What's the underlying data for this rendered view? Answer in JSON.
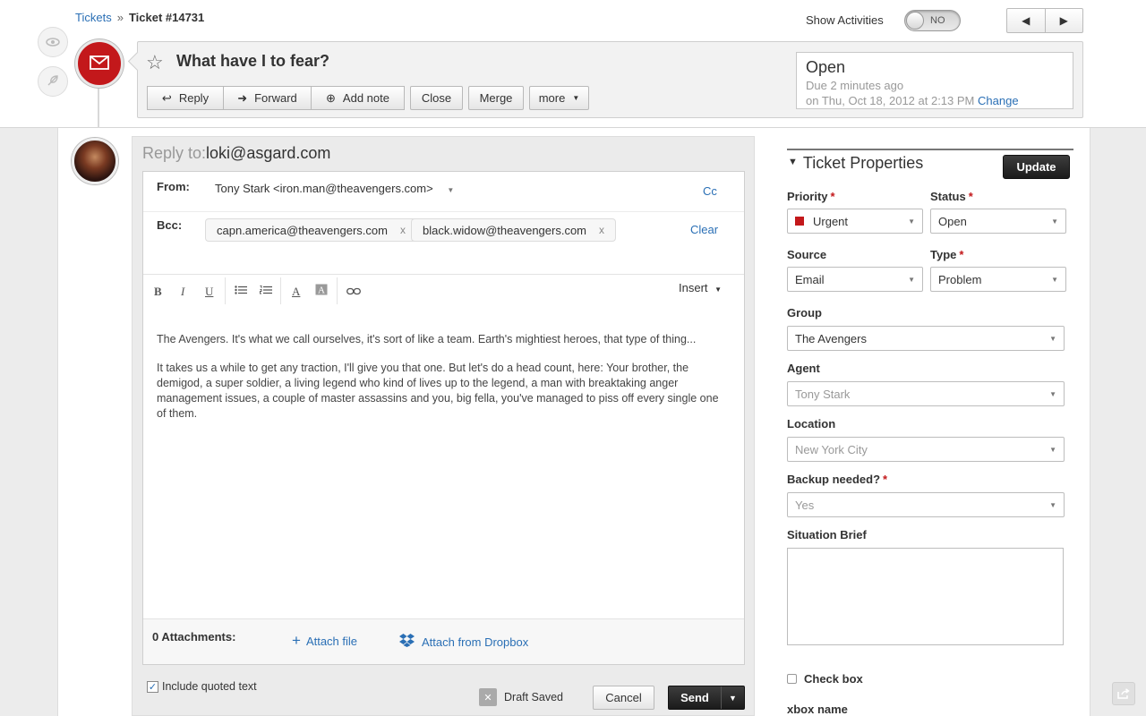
{
  "breadcrumb": {
    "root": "Tickets",
    "separator": "»",
    "current": "Ticket #14731"
  },
  "activities": {
    "label": "Show Activities",
    "toggle": "NO"
  },
  "ticket": {
    "subject": "What have I to fear?",
    "actions": {
      "reply": "Reply",
      "forward": "Forward",
      "add_note": "Add note",
      "close": "Close",
      "merge": "Merge",
      "more": "more"
    },
    "status": {
      "state": "Open",
      "due": "Due 2 minutes ago",
      "on": "on Thu, Oct 18, 2012 at 2:13 PM",
      "change": "Change"
    }
  },
  "reply": {
    "to_label": "Reply to:",
    "to_value": "loki@asgard.com",
    "from_label": "From:",
    "from_value": "Tony Stark <iron.man@theavengers.com>",
    "cc": "Cc",
    "bcc_label": "Bcc:",
    "bcc": [
      {
        "email": "capn.america@theavengers.com",
        "remove": "x"
      },
      {
        "email": "black.widow@theavengers.com",
        "remove": "x"
      }
    ],
    "clear": "Clear",
    "insert": "Insert",
    "body": [
      "The Avengers. It's what we call ourselves, it's sort of like a team. Earth's mightiest heroes, that type of thing...",
      "It takes us a while to get any traction, I'll give you that one. But let's do a head count, here: Your brother, the demigod, a super soldier, a living legend who kind of lives up to the legend, a man with breaktaking anger management issues, a couple of master assassins and you, big fella, you've managed to piss off every single one of them."
    ],
    "attachments": "0 Attachments:",
    "attach_file": "Attach file",
    "attach_dropbox": "Attach from Dropbox",
    "include_quoted": "Include quoted text",
    "draft_saved": "Draft Saved",
    "cancel": "Cancel",
    "send": "Send"
  },
  "properties": {
    "title": "Ticket Properties",
    "update": "Update",
    "priority": {
      "label": "Priority",
      "value": "Urgent"
    },
    "status": {
      "label": "Status",
      "value": "Open"
    },
    "source": {
      "label": "Source",
      "value": "Email"
    },
    "type": {
      "label": "Type",
      "value": "Problem"
    },
    "group": {
      "label": "Group",
      "value": "The Avengers"
    },
    "agent": {
      "label": "Agent",
      "value": "Tony Stark"
    },
    "location": {
      "label": "Location",
      "value": "New York City"
    },
    "backup": {
      "label": "Backup needed?",
      "value": "Yes"
    },
    "brief": {
      "label": "Situation Brief"
    },
    "checkbox": {
      "label": "Check box"
    },
    "xbox": {
      "label": "xbox name"
    }
  },
  "required_marker": "*",
  "colors": {
    "accent": "#c3181b",
    "link": "#2a6fb5",
    "dark_button": "#222222"
  }
}
